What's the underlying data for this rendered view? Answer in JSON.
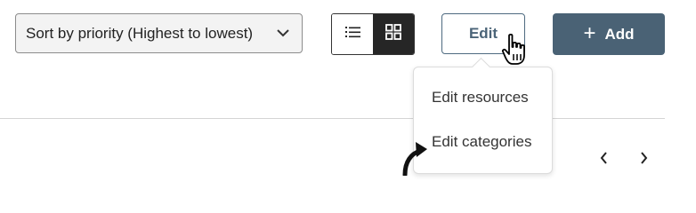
{
  "toolbar": {
    "sort_label": "Sort by priority (Highest to lowest)",
    "view_list_icon": "list-icon",
    "view_grid_icon": "grid-icon",
    "active_view": "grid",
    "edit_label": "Edit",
    "add_label": "Add",
    "add_icon": "plus-icon"
  },
  "edit_menu": {
    "items": [
      {
        "label": "Edit resources"
      },
      {
        "label": "Edit categories"
      }
    ]
  },
  "pagination": {
    "prev_icon": "chevron-left-icon",
    "next_icon": "chevron-right-icon"
  },
  "colors": {
    "primary": "#4a6275",
    "edit_text": "#4b6478",
    "active_toggle": "#262626"
  }
}
